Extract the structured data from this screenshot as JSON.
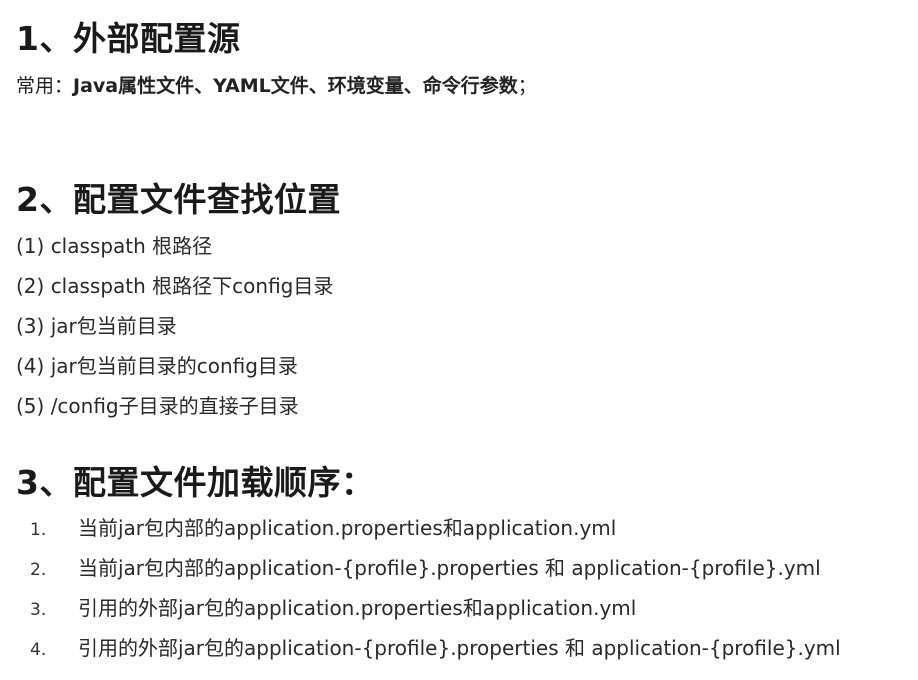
{
  "sections": [
    {
      "title": "1、外部配置源",
      "usage": {
        "prefix": "常用：",
        "items": "Java属性文件、YAML文件、环境变量、命令行参数",
        "suffix": "；"
      }
    },
    {
      "title": "2、配置文件查找位置",
      "items": [
        "(1) classpath 根路径",
        "(2) classpath 根路径下config目录",
        "(3) jar包当前目录",
        "(4) jar包当前目录的config目录",
        "(5) /config子目录的直接子目录"
      ]
    },
    {
      "title": "3、配置文件加载顺序：",
      "items": [
        {
          "num": "1.",
          "text": "当前jar包内部的application.properties和application.yml"
        },
        {
          "num": "2.",
          "text": "当前jar包内部的application-{profile}.properties 和 application-{profile}.yml"
        },
        {
          "num": "3.",
          "text": "引用的外部jar包的application.properties和application.yml"
        },
        {
          "num": "4.",
          "text": "引用的外部jar包的application-{profile}.properties 和 application-{profile}.yml"
        }
      ]
    }
  ]
}
